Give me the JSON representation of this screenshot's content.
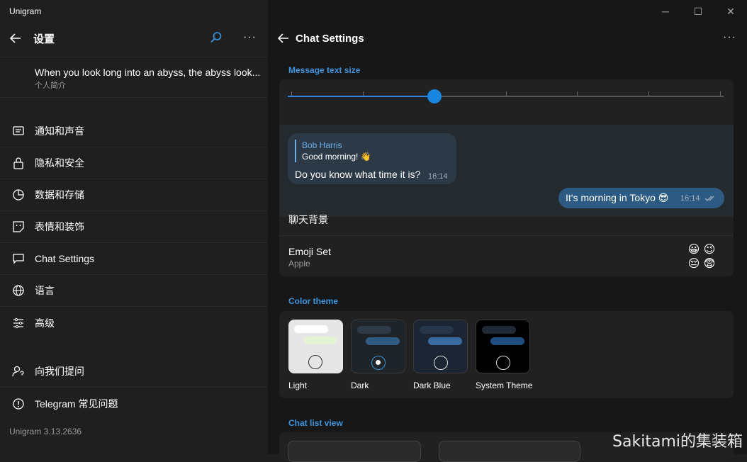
{
  "window": {
    "title": "Unigram"
  },
  "left": {
    "header_title": "设置",
    "profile": {
      "name": "When you look long into an abyss, the abyss look...",
      "bio": "个人简介"
    },
    "menu": [
      {
        "icon": "chat-lines-icon",
        "label": "通知和声音"
      },
      {
        "icon": "lock-icon",
        "label": "隐私和安全"
      },
      {
        "icon": "pie-chart-icon",
        "label": "数据和存储"
      },
      {
        "icon": "sticker-icon",
        "label": "表情和装饰"
      },
      {
        "icon": "chat-bubble-icon",
        "label": "Chat Settings"
      },
      {
        "icon": "globe-icon",
        "label": "语言"
      },
      {
        "icon": "sliders-icon",
        "label": "高级"
      },
      {
        "icon": "person-question-icon",
        "label": "向我们提问"
      },
      {
        "icon": "info-circle-icon",
        "label": "Telegram 常见问题"
      }
    ],
    "version": "Unigram 3.13.2636"
  },
  "right": {
    "header_title": "Chat Settings",
    "text_size_title": "Message text size",
    "slider": {
      "steps": 7,
      "value_index": 2
    },
    "preview": {
      "reply_name": "Bob Harris",
      "reply_text": "Good morning! 👋",
      "incoming_text": "Do you know what time it is?",
      "incoming_time": "16:14",
      "outgoing_text": "It's morning in Tokyo 😎",
      "outgoing_time": "16:14"
    },
    "background_label": "聊天背景",
    "emoji_set": {
      "label": "Emoji Set",
      "value": "Apple",
      "emojis": [
        "😀",
        "😉",
        "😔",
        "😨"
      ]
    },
    "color_theme_title": "Color theme",
    "themes": [
      {
        "label": "Light",
        "selected": false,
        "bg": "#e6e6e6"
      },
      {
        "label": "Dark",
        "selected": true,
        "bg": "#1f2428"
      },
      {
        "label": "Dark Blue",
        "selected": false,
        "bg": "#1c2533"
      },
      {
        "label": "System Theme",
        "selected": false,
        "bg": "#000000"
      }
    ],
    "chat_list_title": "Chat list view"
  },
  "watermark": "Sakitami的集装箱",
  "colors": {
    "accent": "#2b88d8",
    "outgoing_bubble": "#2d5a82",
    "incoming_bubble": "#2c3a47"
  }
}
